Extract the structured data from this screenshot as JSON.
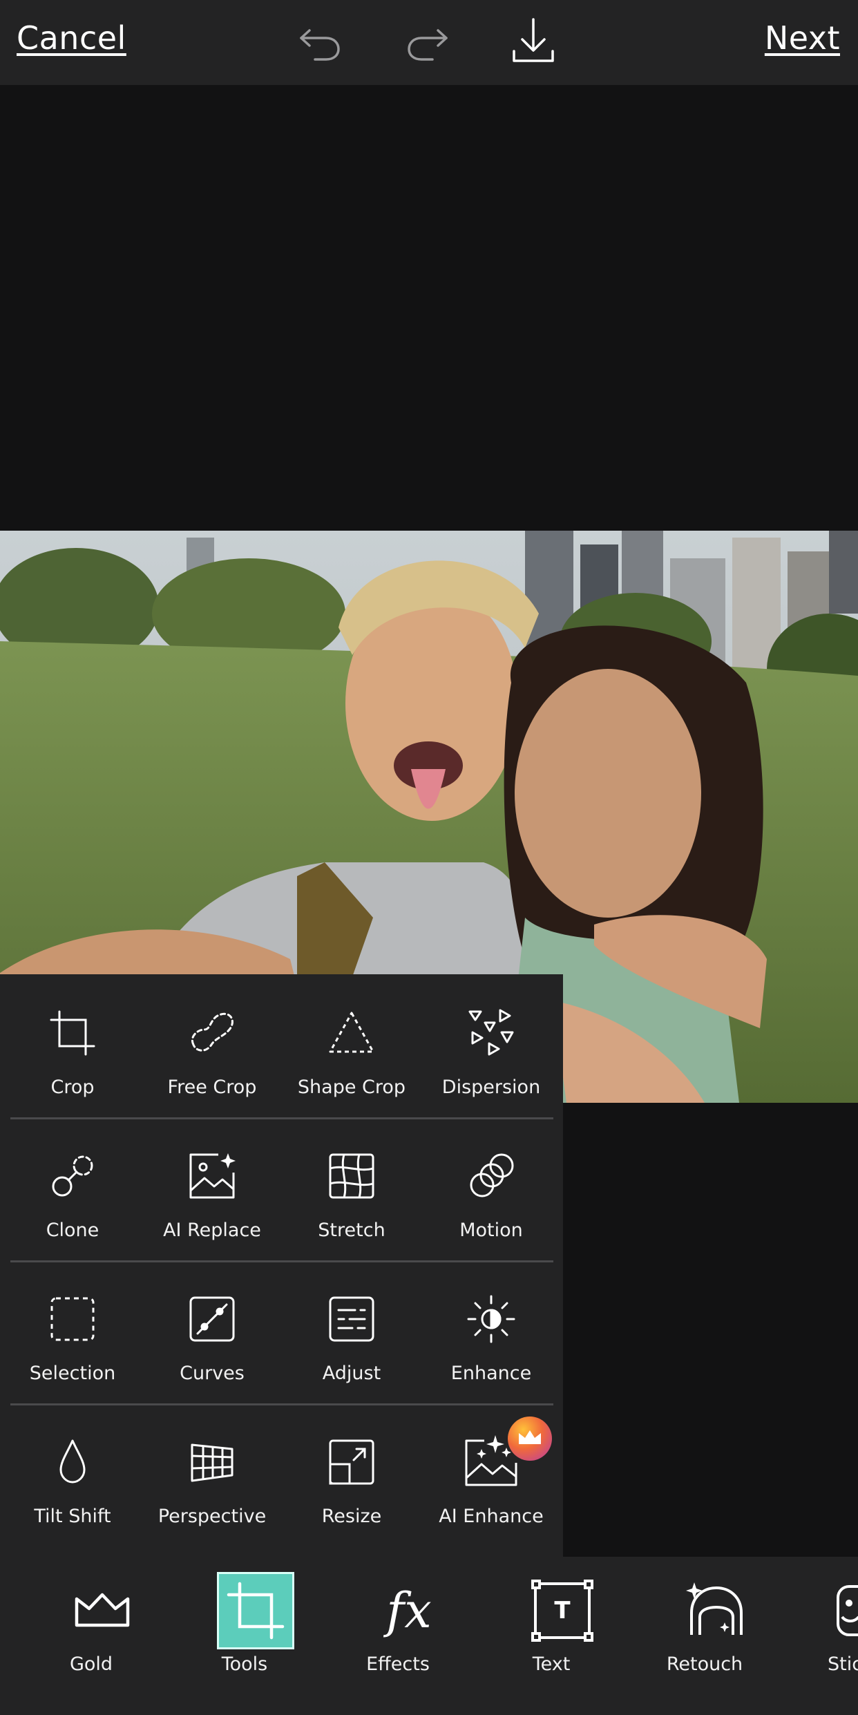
{
  "topbar": {
    "cancel_label": "Cancel",
    "next_label": "Next",
    "icons": [
      "undo-icon",
      "redo-icon",
      "download-icon"
    ]
  },
  "tools": {
    "rows": [
      [
        {
          "label": "Crop",
          "icon": "crop-icon"
        },
        {
          "label": "Free Crop",
          "icon": "free-crop-icon"
        },
        {
          "label": "Shape Crop",
          "icon": "shape-crop-icon"
        },
        {
          "label": "Dispersion",
          "icon": "dispersion-icon"
        }
      ],
      [
        {
          "label": "Clone",
          "icon": "clone-icon"
        },
        {
          "label": "AI Replace",
          "icon": "ai-replace-icon"
        },
        {
          "label": "Stretch",
          "icon": "stretch-icon"
        },
        {
          "label": "Motion",
          "icon": "motion-icon"
        }
      ],
      [
        {
          "label": "Selection",
          "icon": "selection-icon"
        },
        {
          "label": "Curves",
          "icon": "curves-icon"
        },
        {
          "label": "Adjust",
          "icon": "adjust-icon"
        },
        {
          "label": "Enhance",
          "icon": "enhance-icon"
        }
      ],
      [
        {
          "label": "Tilt Shift",
          "icon": "tilt-shift-icon"
        },
        {
          "label": "Perspective",
          "icon": "perspective-icon"
        },
        {
          "label": "Resize",
          "icon": "resize-icon"
        },
        {
          "label": "AI Enhance",
          "icon": "ai-enhance-icon",
          "premium": true
        }
      ]
    ]
  },
  "bottom_nav": {
    "items": [
      {
        "label": "Gold",
        "icon": "crown-icon"
      },
      {
        "label": "Tools",
        "icon": "crop-icon",
        "active": true
      },
      {
        "label": "Effects",
        "icon": "fx-icon",
        "glyph": "fx"
      },
      {
        "label": "Text",
        "icon": "text-icon",
        "glyph": "T"
      },
      {
        "label": "Retouch",
        "icon": "retouch-icon"
      },
      {
        "label": "Stic",
        "icon": "sticker-icon"
      }
    ]
  },
  "colors": {
    "background": "#121213",
    "panel": "#232324",
    "active_accent": "#5ccdbb",
    "premium_badge": "#d84a8c"
  }
}
